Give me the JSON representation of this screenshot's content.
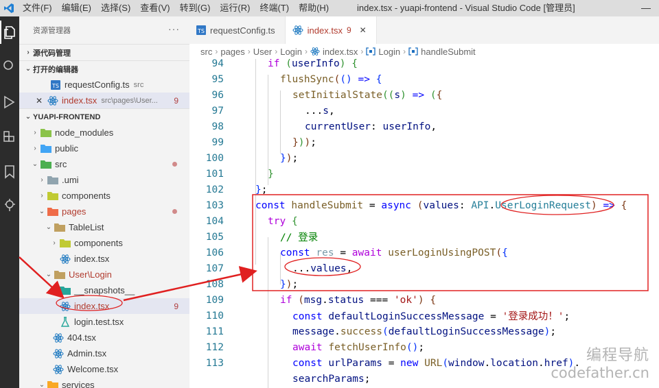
{
  "menubar": {
    "items": [
      "文件(F)",
      "编辑(E)",
      "选择(S)",
      "查看(V)",
      "转到(G)",
      "运行(R)",
      "终端(T)",
      "帮助(H)"
    ],
    "window_title": "index.tsx - yuapi-frontend - Visual Studio Code [管理员]",
    "minimize": "—"
  },
  "sidebar": {
    "title": "资源管理器",
    "more": "···",
    "source_control": "源代码管理",
    "open_editors": "打开的编辑器",
    "open_files": [
      {
        "name": "requestConfig.ts",
        "path": "src"
      },
      {
        "name": "index.tsx",
        "path": "src\\pages\\User...",
        "badge": "9"
      }
    ],
    "project": "YUAPI-FRONTEND",
    "tree": {
      "node_modules": "node_modules",
      "public": "public",
      "src": "src",
      "umi": ".umi",
      "components": "components",
      "pages": "pages",
      "tablelist": "TableList",
      "tablelist_components": "components",
      "tablelist_index": "index.tsx",
      "user_login": "User\\Login",
      "snapshots": "__snapshots__",
      "index_tsx": "index.tsx",
      "index_badge": "9",
      "login_test": "login.test.tsx",
      "f404": "404.tsx",
      "admin": "Admin.tsx",
      "welcome": "Welcome.tsx",
      "services": "services"
    }
  },
  "tabs": [
    {
      "label": "requestConfig.ts"
    },
    {
      "label": "index.tsx",
      "badge": "9",
      "close": "✕"
    }
  ],
  "breadcrumb": [
    "src",
    "pages",
    "User",
    "Login",
    "index.tsx",
    "Login",
    "handleSubmit"
  ],
  "code": {
    "line_numbers": [
      "94",
      "95",
      "96",
      "97",
      "98",
      "99",
      "100",
      "101",
      "102",
      "103",
      "104",
      "105",
      "106",
      "107",
      "108",
      "109",
      "110",
      "111",
      "112",
      "113"
    ]
  },
  "watermark": {
    "cn": "编程导航",
    "en": "codefather.cn"
  },
  "colors": {
    "annotation_red": "#e02020",
    "activity_bar": "#2c2c2c",
    "sidebar": "#f3f3f3",
    "keyword": "#0000ff",
    "control": "#af00db",
    "function": "#795e26",
    "string": "#a31515",
    "comment": "#008000"
  },
  "icons": {
    "activity": [
      "explorer-icon",
      "search-icon",
      "run-debug-icon",
      "extensions-icon",
      "bookmarks-icon",
      "remote-icon"
    ]
  }
}
